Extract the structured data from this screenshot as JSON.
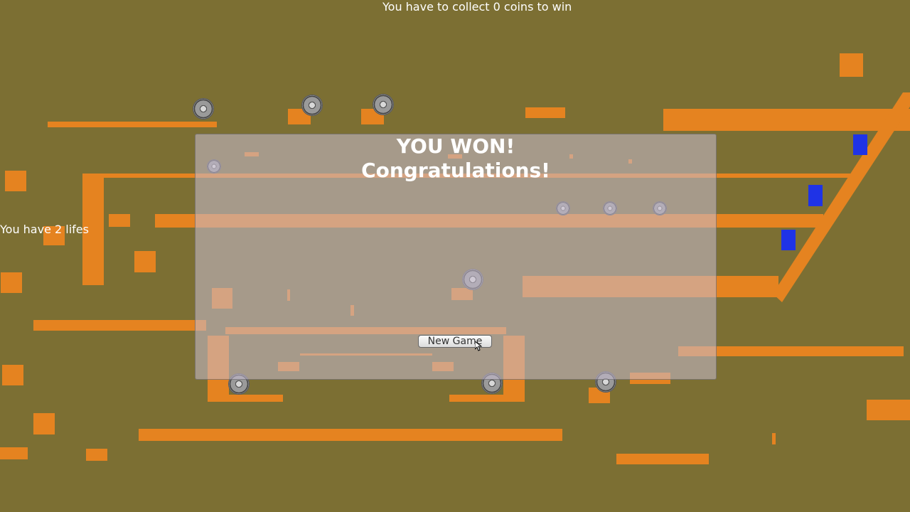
{
  "hud": {
    "goal_text": "You have to collect 0 coins to win",
    "lives_text": "You have 2 lifes"
  },
  "dialog": {
    "title_line1": "YOU WON!",
    "title_line2": "Congratulations!",
    "new_game_label": "New Game"
  },
  "colors": {
    "background": "#7c6f33",
    "platform": "#e58320",
    "enemy": "#1f33e6"
  },
  "icons": [
    "coin-icon",
    "cursor-icon"
  ]
}
